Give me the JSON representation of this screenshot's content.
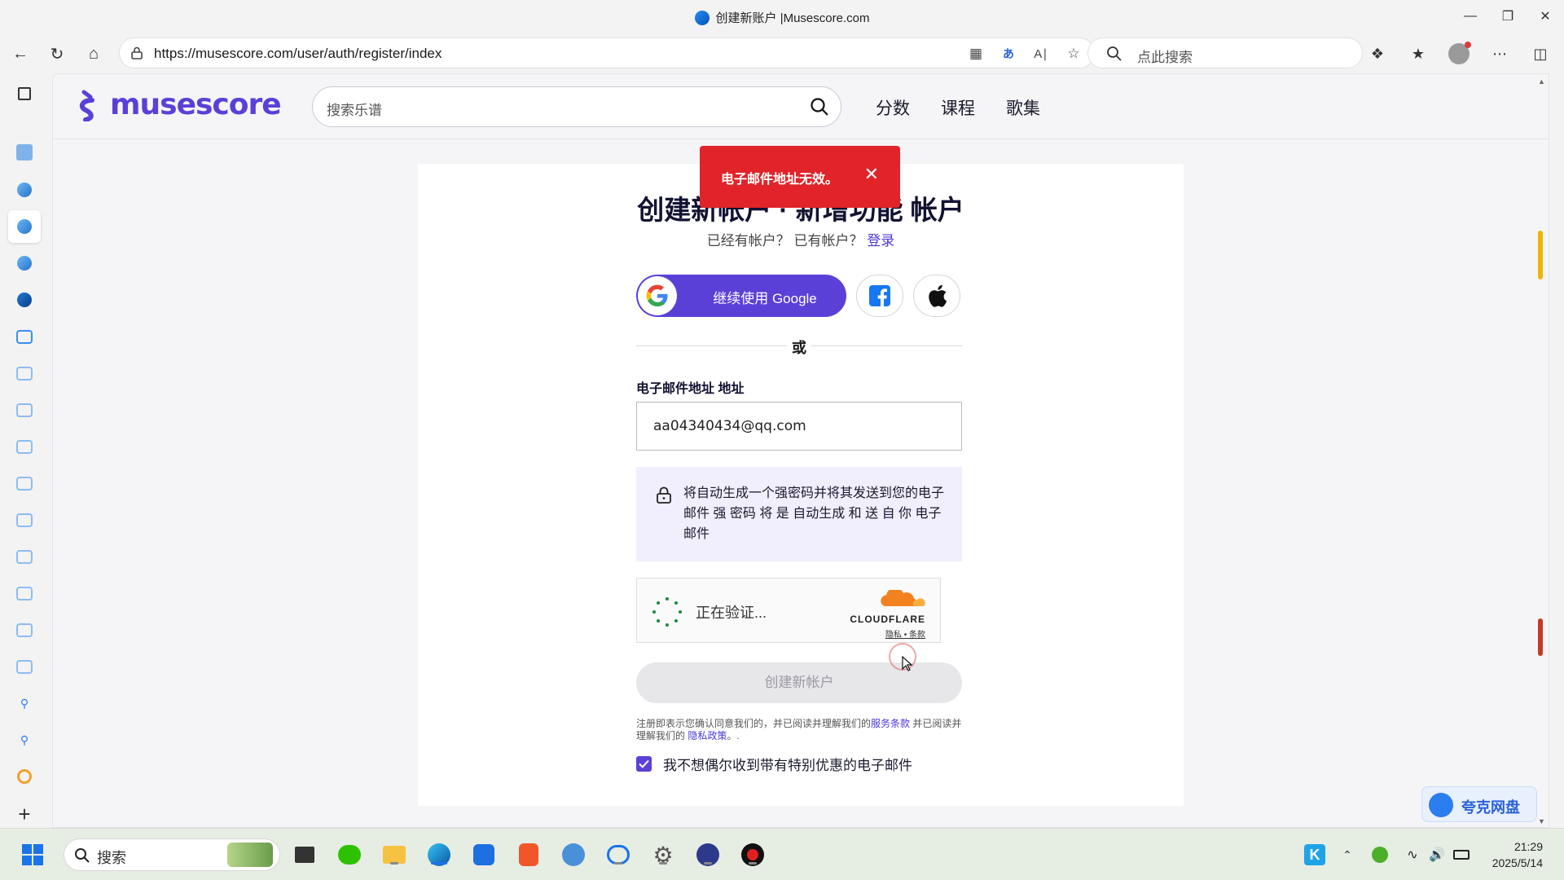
{
  "window": {
    "title": "创建新账户 |Musescore.com"
  },
  "browser": {
    "url": "https://musescore.com/user/auth/register/index",
    "search_placeholder": "点此搜索"
  },
  "site": {
    "logo_text": "musescore",
    "search_placeholder": "搜索乐谱",
    "nav": [
      "分数",
      "课程",
      "歌集"
    ]
  },
  "toast": {
    "message": "电子邮件地址无效。"
  },
  "form": {
    "heading": "创建新帐户 · 新增功能 帐户",
    "subtitle_prefix": "已经有帐户？ 已有帐户？",
    "login_link": "登录",
    "google_label": "继续使用 Google",
    "or_label": "或",
    "email_label": "电子邮件地址 地址",
    "email_value": "aa04340434@qq.com",
    "password_info": "将自动生成一个强密码并将其发送到您的电子邮件 强 密码 将 是 自动生成 和 送 自 你 电子邮件",
    "captcha_status": "正在验证...",
    "captcha_brand": "CLOUDFLARE",
    "captcha_links": "隐私 • 条款",
    "create_button": "创建新帐户",
    "legal_prefix": "注册即表示您确认同意我们的，并已阅读并理解我们的",
    "legal_terms": "服务条款",
    "legal_middle": " 并已阅读并理解我们的 ",
    "legal_privacy": "隐私政策",
    "legal_suffix": "。.",
    "optout_label": "我不想偶尔收到带有特别优惠的电子邮件",
    "optout_checked": true
  },
  "quark": {
    "label": "夸克网盘"
  },
  "taskbar": {
    "search_placeholder": "搜索",
    "time": "21:29",
    "date": "2025/5/14"
  },
  "colors": {
    "brand": "#5b40d8",
    "toast": "#e0242a"
  }
}
